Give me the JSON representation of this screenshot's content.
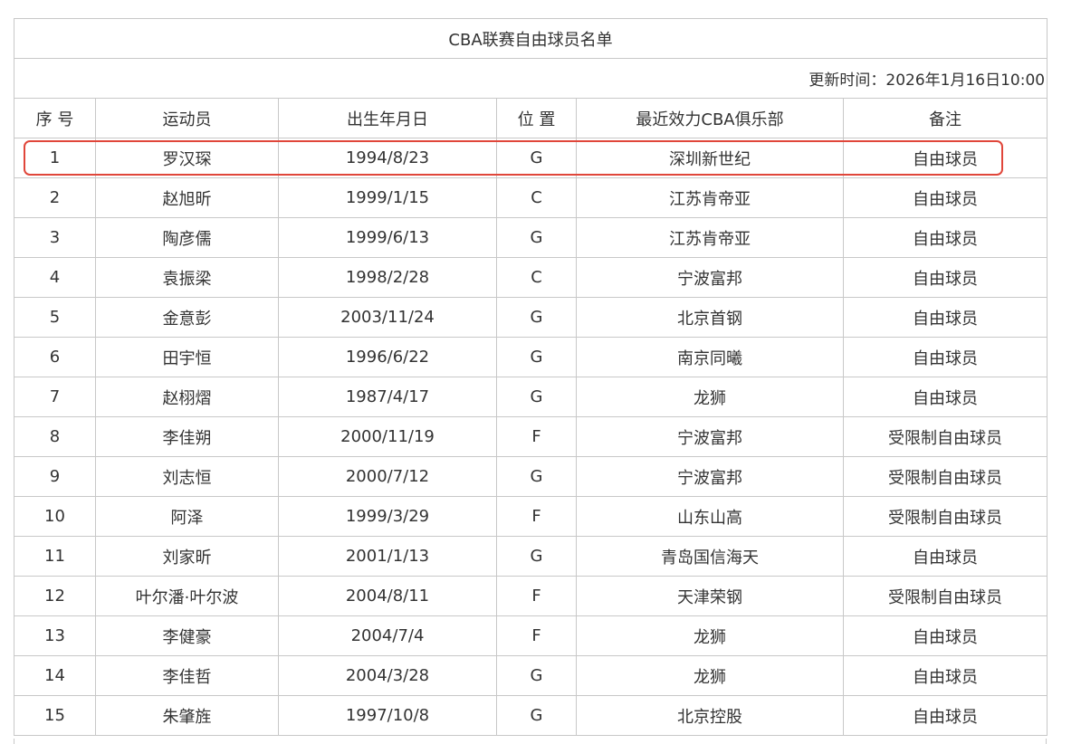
{
  "title": "CBA联赛自由球员名单",
  "update_time": "更新时间：2026年1月16日10:00",
  "columns": [
    "序 号",
    "运动员",
    "出生年月日",
    "位 置",
    "最近效力CBA俱乐部",
    "备注"
  ],
  "rows": [
    {
      "no": "1",
      "name": "罗汉琛",
      "birth": "1994/8/23",
      "pos": "G",
      "club": "深圳新世纪",
      "note": "自由球员"
    },
    {
      "no": "2",
      "name": "赵旭昕",
      "birth": "1999/1/15",
      "pos": "C",
      "club": "江苏肯帝亚",
      "note": "自由球员"
    },
    {
      "no": "3",
      "name": "陶彦儒",
      "birth": "1999/6/13",
      "pos": "G",
      "club": "江苏肯帝亚",
      "note": "自由球员"
    },
    {
      "no": "4",
      "name": "袁振梁",
      "birth": "1998/2/28",
      "pos": "C",
      "club": "宁波富邦",
      "note": "自由球员"
    },
    {
      "no": "5",
      "name": "金意彭",
      "birth": "2003/11/24",
      "pos": "G",
      "club": "北京首钢",
      "note": "自由球员"
    },
    {
      "no": "6",
      "name": "田宇恒",
      "birth": "1996/6/22",
      "pos": "G",
      "club": "南京同曦",
      "note": "自由球员"
    },
    {
      "no": "7",
      "name": "赵栩熠",
      "birth": "1987/4/17",
      "pos": "G",
      "club": "龙狮",
      "note": "自由球员"
    },
    {
      "no": "8",
      "name": "李佳朔",
      "birth": "2000/11/19",
      "pos": "F",
      "club": "宁波富邦",
      "note": "受限制自由球员"
    },
    {
      "no": "9",
      "name": "刘志恒",
      "birth": "2000/7/12",
      "pos": "G",
      "club": "宁波富邦",
      "note": "受限制自由球员"
    },
    {
      "no": "10",
      "name": "阿泽",
      "birth": "1999/3/29",
      "pos": "F",
      "club": "山东山高",
      "note": "受限制自由球员"
    },
    {
      "no": "11",
      "name": "刘家昕",
      "birth": "2001/1/13",
      "pos": "G",
      "club": "青岛国信海天",
      "note": "自由球员"
    },
    {
      "no": "12",
      "name": "叶尔潘·叶尔波",
      "birth": "2004/8/11",
      "pos": "F",
      "club": "天津荣钢",
      "note": "受限制自由球员"
    },
    {
      "no": "13",
      "name": "李健豪",
      "birth": "2004/7/4",
      "pos": "F",
      "club": "龙狮",
      "note": "自由球员"
    },
    {
      "no": "14",
      "name": "李佳哲",
      "birth": "2004/3/28",
      "pos": "G",
      "club": "龙狮",
      "note": "自由球员"
    },
    {
      "no": "15",
      "name": "朱肇旌",
      "birth": "1997/10/8",
      "pos": "G",
      "club": "北京控股",
      "note": "自由球员"
    }
  ],
  "highlight_color": "#e0463a"
}
